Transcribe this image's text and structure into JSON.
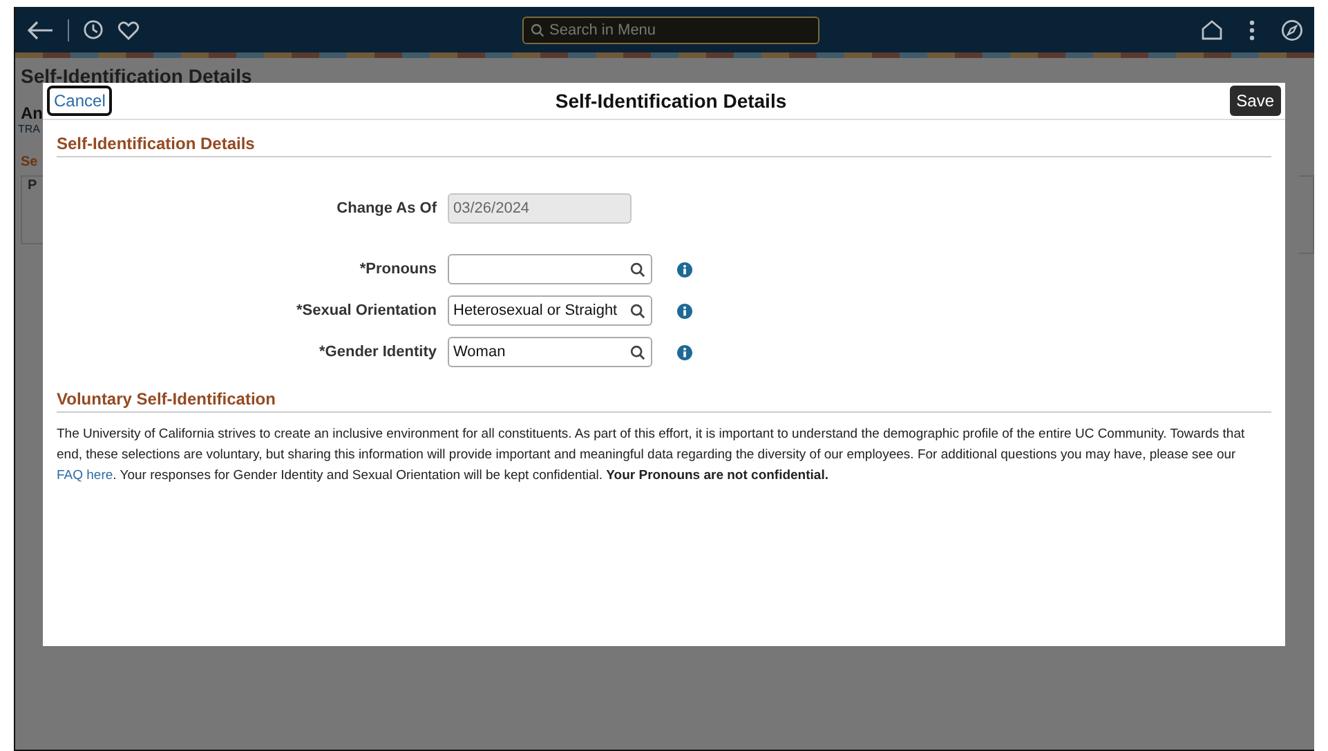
{
  "top_bar": {
    "search": {
      "placeholder": "Search in Menu"
    }
  },
  "background_page": {
    "title": "Self-Identification Details",
    "name_fragment": "An",
    "subtitle_fragment": "TRA",
    "section_fragment": "Se",
    "column_fragment": "P"
  },
  "dialog": {
    "title": "Self-Identification Details",
    "cancel": "Cancel",
    "save": "Save",
    "section_title": "Self-Identification Details",
    "fields": [
      {
        "kind": "readonly",
        "label": "Change As Of",
        "value": "03/26/2024",
        "info": false
      },
      {
        "kind": "lookup",
        "label": "*Pronouns",
        "info": true
      },
      {
        "kind": "lookup",
        "label": "*Sexual Orientation",
        "value": "Heterosexual or Straight",
        "info": true
      },
      {
        "kind": "lookup",
        "label": "*Gender Identity",
        "value": "Woman",
        "info": true
      }
    ],
    "voluntary": {
      "title": "Voluntary Self-Identification",
      "text": "The University of California strives to create an inclusive environment for all constituents. As part of this effort, it is important to understand the demographic profile of the entire UC Community. Towards that end, these selections are voluntary, but sharing this information will provide important and meaningful data regarding the diversity of our employees. For additional questions you may have, please see our",
      "link": "FAQ here",
      "text_after": ". Your responses for Gender Identity and Sexual Orientation will be kept confidential. **Your Pronouns are not confidential.**"
    }
  }
}
